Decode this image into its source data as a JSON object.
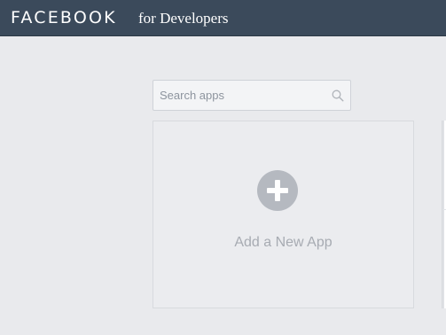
{
  "header": {
    "brand": "FACEBOOK",
    "subtitle": "for Developers"
  },
  "search": {
    "placeholder": "Search apps",
    "icon": "search-icon"
  },
  "add_app_card": {
    "label": "Add a New App",
    "icon": "plus-circle-icon"
  },
  "colors": {
    "topbar": "#3b4a5b",
    "background": "#e9eaed",
    "plus_circle": "#b5b9c0",
    "muted_text": "#a7abb2"
  }
}
